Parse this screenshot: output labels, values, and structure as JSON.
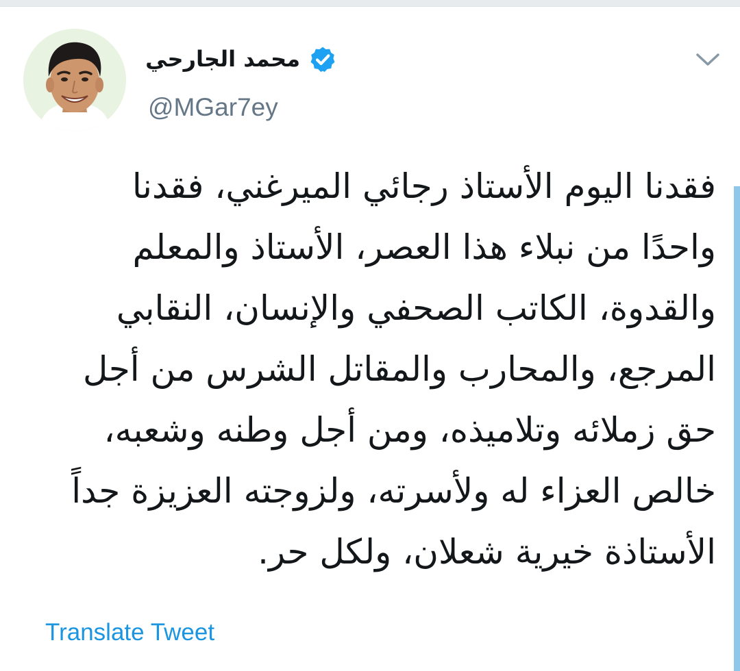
{
  "tweet": {
    "display_name": "محمد الجارحي",
    "verified": true,
    "handle": "@MGar7ey",
    "text": "فقدنا اليوم الأستاذ رجائي الميرغني، فقدنا\nواحدًا من نبلاء هذا العصر، الأستاذ والمعلم\nوالقدوة، الكاتب الصحفي والإنسان، النقابي\nالمرجع، والمحارب والمقاتل الشرس من أجل\nحق زملائه وتلاميذه، ومن أجل وطنه وشعبه،\nخالص العزاء له ولأسرته، ولزوجته العزيزة جداً\nالأستاذة خيرية شعلان، ولكل حر.",
    "translate_label": "Translate Tweet"
  },
  "icons": {
    "verified": "verified-badge-icon",
    "menu": "chevron-down-icon",
    "avatar": "profile-photo"
  },
  "colors": {
    "text": "#14171a",
    "secondary": "#657786",
    "link": "#1b95e0",
    "verified": "#1da1f2",
    "scrollbar": "#8fc7ea"
  }
}
